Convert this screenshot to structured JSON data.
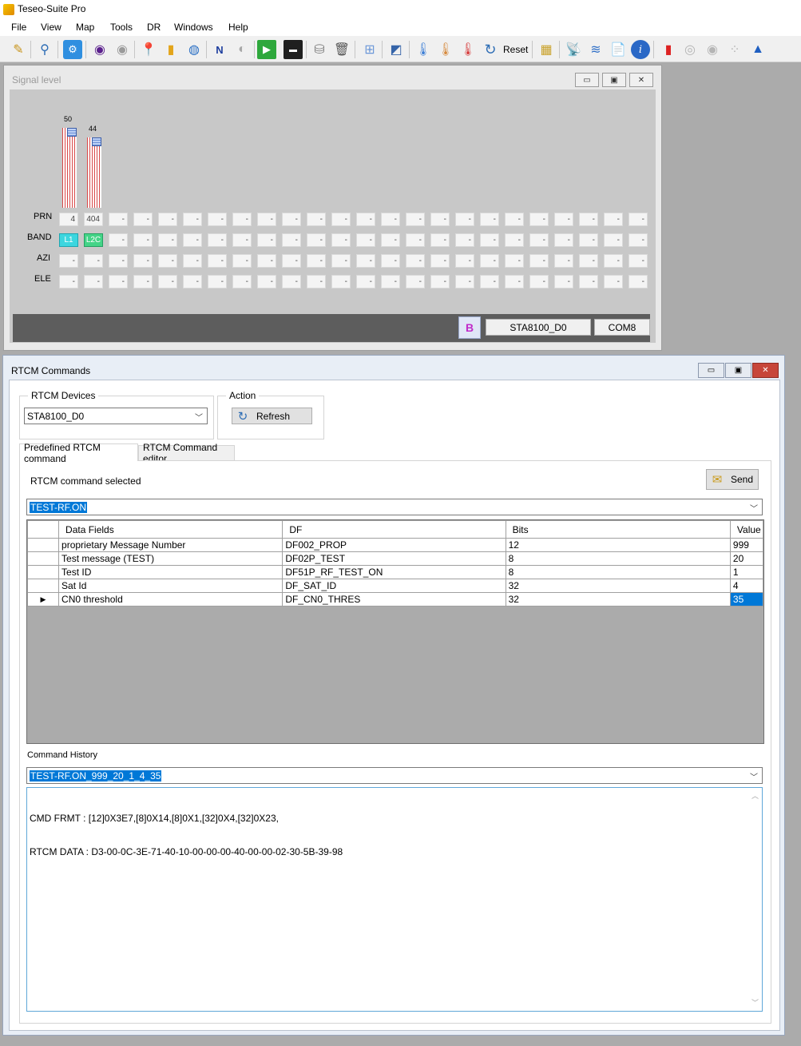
{
  "app": {
    "title": "Teseo-Suite Pro"
  },
  "menu": [
    "File",
    "View",
    "Map",
    "Tools",
    "DR",
    "Windows",
    "Help"
  ],
  "toolbar": {
    "reset_label": "Reset"
  },
  "signal_window": {
    "title": "Signal level",
    "bars": [
      {
        "value": "50",
        "level": 50
      },
      {
        "value": "44",
        "level": 44
      }
    ],
    "row_labels": {
      "prn": "PRN",
      "band": "BAND",
      "azi": "AZI",
      "ele": "ELE"
    },
    "prn": [
      "4",
      "404"
    ],
    "band": [
      "L1",
      "L2C"
    ],
    "empty_cell": "-",
    "device": "STA8100_D0",
    "port": "COM8"
  },
  "rtcm_window": {
    "title": "RTCM Commands",
    "devices_label": "RTCM Devices",
    "device_selected": "STA8100_D0",
    "action_label": "Action",
    "refresh_label": "Refresh",
    "tabs": [
      "Predefined RTCM command",
      "RTCM Command editor"
    ],
    "command_selected_label": "RTCM command selected",
    "send_label": "Send",
    "command_selected": "TEST-RF.ON",
    "columns": [
      "Data Fields",
      "DF",
      "Bits",
      "Value"
    ],
    "rows": [
      {
        "field": "proprietary Message Number",
        "df": "DF002_PROP",
        "bits": "12",
        "value": "999"
      },
      {
        "field": "Test message (TEST)",
        "df": "DF02P_TEST",
        "bits": "8",
        "value": "20"
      },
      {
        "field": "Test ID",
        "df": "DF51P_RF_TEST_ON",
        "bits": "8",
        "value": "1"
      },
      {
        "field": "Sat Id",
        "df": "DF_SAT_ID",
        "bits": "32",
        "value": "4"
      },
      {
        "field": "CN0 threshold",
        "df": "DF_CN0_THRES",
        "bits": "32",
        "value": "35"
      }
    ],
    "history_label": "Command History",
    "history_selected": "TEST-RF.ON_999_20_1_4_35",
    "output_lines": [
      "CMD FRMT : [12]0X3E7,[8]0X14,[8]0X1,[32]0X4,[32]0X23,",
      "RTCM DATA : D3-00-0C-3E-71-40-10-00-00-00-40-00-00-02-30-5B-39-98"
    ]
  },
  "colors": {
    "selection": "#0078d7",
    "band_l1": "#3cd6df",
    "band_l2c": "#44d487",
    "bar_red": "#d84848"
  }
}
